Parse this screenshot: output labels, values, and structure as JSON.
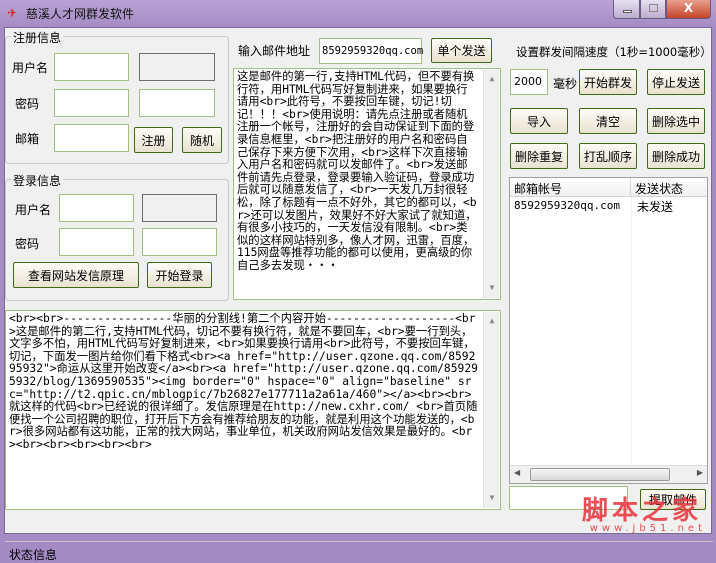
{
  "window": {
    "title": "慈溪人才网群发软件"
  },
  "register": {
    "title": "注册信息",
    "username_label": "用户名",
    "password_label": "密码",
    "email_label": "邮箱",
    "register_button": "注册",
    "random_button": "随机"
  },
  "login": {
    "title": "登录信息",
    "username_label": "用户名",
    "password_label": "密码",
    "principle_button": "查看网站发信原理",
    "login_button": "开始登录"
  },
  "single": {
    "label": "输入邮件地址",
    "email_value": "8592959320qq.com",
    "send_button": "单个发送"
  },
  "interval": {
    "label": "设置群发间隔速度（1秒=1000毫秒）",
    "value": "2000",
    "unit": "毫秒"
  },
  "buttons": {
    "start": "开始群发",
    "stop": "停止发送",
    "import": "导入",
    "clear": "清空",
    "delete_selected": "删除选中",
    "delete_duplicate": "删除重复",
    "shuffle": "打乱顺序",
    "delete_success": "删除成功",
    "extract": "提取邮件"
  },
  "content1": "这是邮件的第一行,支持HTML代码，但不要有换行符，用HTML代码写好复制进来，如果要换行请用<br>此符号，不要按回车键，切记!切记！！！<br>使用说明：请先点注册或者随机注册一个帐号，注册好的会自动保证到下面的登录信息框里，<br>把注册好的用户名和密码自己保存下来方便下次用，<br>这样下次直接输入用户名和密码就可以发邮件了。<br>发送邮件前请先点登录，登录要输入验证码，登录成功后就可以随意发信了，<br>一天发几万封很轻松，除了标题有一点不好外，其它的都可以，<br>还可以发图片，效果好不好大家试了就知道，有很多小技巧的，一天发信没有限制。<br>类似的这样网站特别多，像人才网，迅雷，百度，115网盘等推荐功能的都可以使用，更高级的你自己多去发现・・・",
  "content2": "<br><br>----------------华丽的分割线!第二个内容开始-------------------<br>这是邮件的第二行,支持HTML代码，切记不要有换行符，就是不要回车，<br>要一行到头，文字多不怕，用HTML代码写好复制进来，<br>如果要换行请用<br>此符号，不要按回车键，切记，下面发一图片给你们看下格式<br><a href=\"http://user.qzone.qq.com/859295932\">命运从这里开始改变</a><br><a href=\"http://user.qzone.qq.com/859295932/blog/1369590535\"><img border=\"0\" hspace=\"0\" align=\"baseline\" src=\"http://t2.qpic.cn/mblogpic/7b26827e177711a2a61a/460\"></a><br><br>就这样的代码<br>已经说的很详细了。发信原理是在http://new.cxhr.com/ <br>首页随便找一个公司招聘的职位，打开后下方会有推荐给朋友的功能，就是利用这个功能发送的，<br>很多网站都有这功能，正常的找大网站，事业单位，机关政府网站发信效果是最好的。<br><br><br><br><br><br>",
  "list": {
    "columns": [
      "邮箱帐号",
      "发送状态"
    ],
    "rows": [
      {
        "email": "8592959320qq.com",
        "status": "未发送"
      }
    ]
  },
  "status": "状态信息",
  "watermark": {
    "text": "脚本之家",
    "url": "www.jb51.net"
  }
}
